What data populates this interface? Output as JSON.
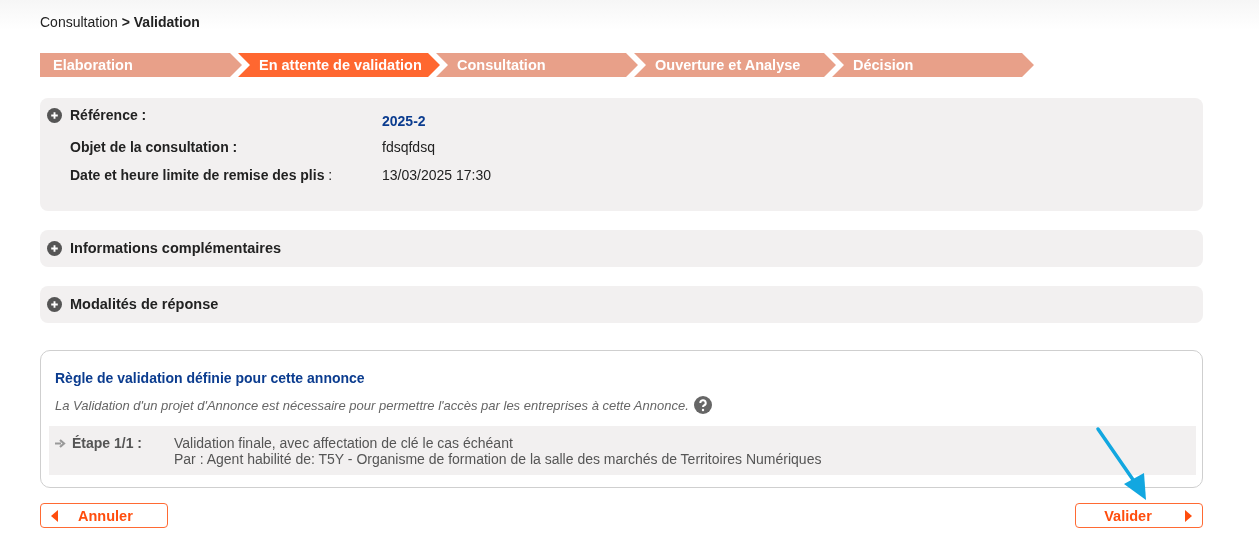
{
  "breadcrumb": "Consultation **> Validation**",
  "steps": [
    {
      "label": "Elaboration",
      "selected": false
    },
    {
      "label": "En attente de validation",
      "selected": true
    },
    {
      "label": "Consultation",
      "selected": false
    },
    {
      "label": "Ouverture et Analyse",
      "selected": false
    },
    {
      "label": "Décision",
      "selected": false
    }
  ],
  "summary": {
    "fields": [
      {
        "label": "Référence :",
        "value": "2025-2",
        "kind": "reference"
      },
      {
        "label": "Objet de la consultation :",
        "value": "fdsqfdsq",
        "kind": "text"
      },
      {
        "label": "Date et heure limite de remise des plis",
        "suffix": ":",
        "value": "13/03/2025 17:30",
        "kind": "text"
      }
    ]
  },
  "sections": [
    {
      "title": "Informations complémentaires"
    },
    {
      "title": "Modalités de réponse"
    }
  ],
  "validation_rule": {
    "title": "Règle de validation définie pour cette annonce",
    "note": "La Validation d'un projet d'Annonce est nécessaire pour permettre l'accès par les entreprises à cette Annonce.",
    "steps": [
      {
        "label": "Étape 1/1 :",
        "lines": [
          "Validation finale, avec affectation de clé le cas échéant",
          "Par : Agent habilité de: T5Y - Organisme de formation de la salle des marchés de Territoires Numériques"
        ]
      }
    ]
  },
  "buttons": [
    {
      "label": "Annuler",
      "kind": "back"
    },
    {
      "label": "Valider",
      "kind": "next"
    }
  ]
}
